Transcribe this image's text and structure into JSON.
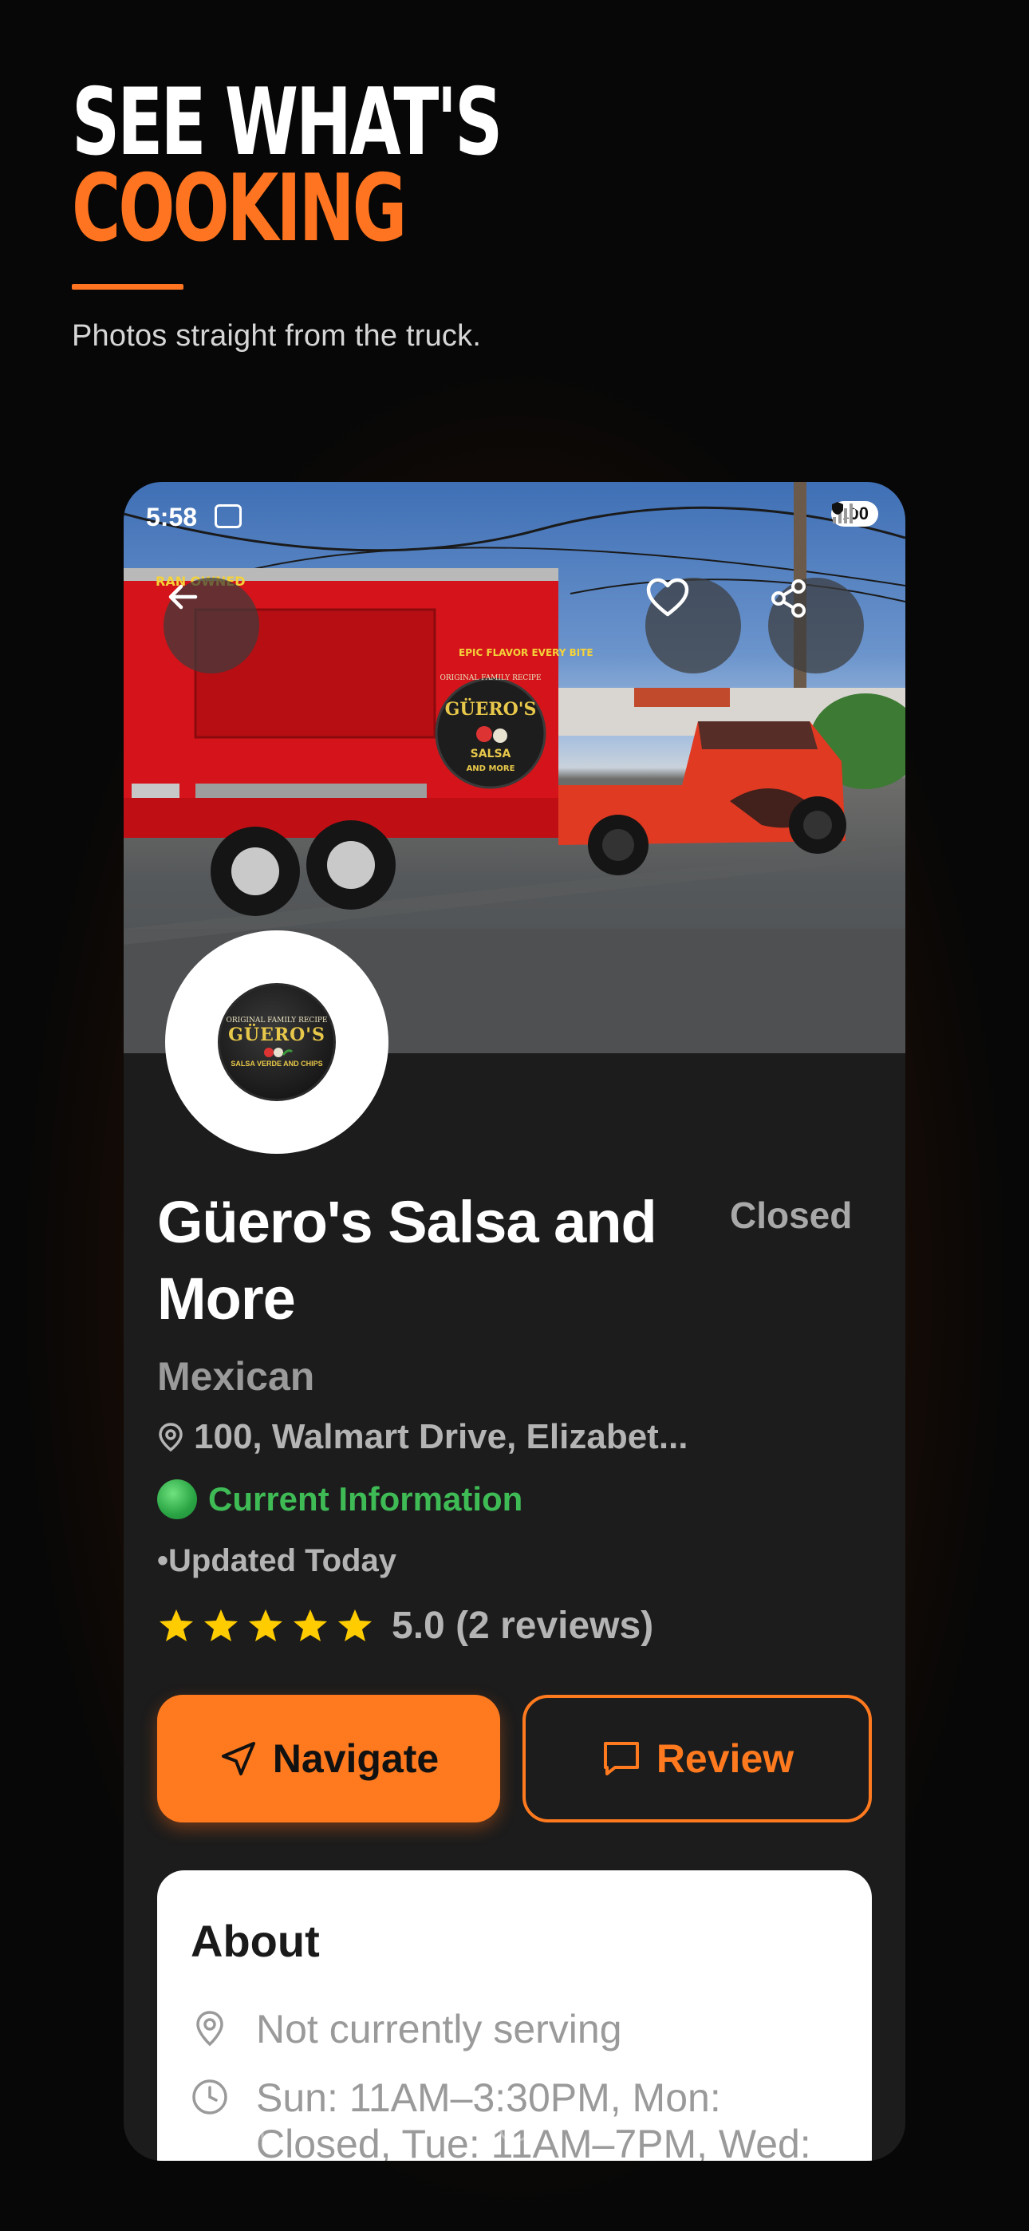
{
  "hero": {
    "line1": "SEE WHAT'S",
    "line2": "COOKING",
    "subtitle": "Photos straight from the truck.",
    "accent_color": "#ff7420"
  },
  "status_bar": {
    "time": "5:58",
    "battery": "100",
    "network_badge": "5"
  },
  "photo": {
    "trailer_top_text": "EPIC FLAVOR EVERY BITE",
    "trailer_side_text": "RAN OWNED",
    "trailer_logo_small": "ORIGINAL FAMILY RECIPE",
    "trailer_logo_name": "GÜERO'S",
    "trailer_logo_sub1": "SALSA",
    "trailer_logo_sub2": "AND MORE"
  },
  "icons": {
    "back": "arrow-left-icon",
    "favorite": "heart-icon",
    "share": "share-icon"
  },
  "logo": {
    "top_text": "ORIGINAL FAMILY RECIPE",
    "name": "GÜERO'S",
    "sub_text": "SALSA VERDE AND CHIPS"
  },
  "vendor": {
    "name": "Güero's Salsa and More",
    "status": "Closed",
    "cuisine": "Mexican",
    "address": "100, Walmart Drive, Elizabet...",
    "info_status": "Current Information",
    "updated": "•Updated Today",
    "rating_value": "5.0 (2 reviews)",
    "rating": 5,
    "max_rating": 5
  },
  "actions": {
    "navigate_label": "Navigate",
    "review_label": "Review",
    "primary_color": "#ff7a1f"
  },
  "about": {
    "title": "About",
    "serving_status": "Not currently serving",
    "hours": "Sun: 11AM–3:30PM, Mon: Closed, Tue: 11AM–7PM, Wed:"
  }
}
